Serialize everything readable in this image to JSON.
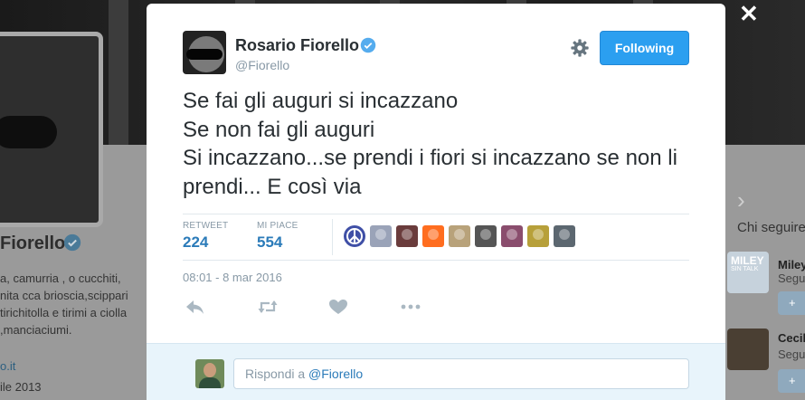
{
  "colors": {
    "accent": "#2b9ff0",
    "link": "#2b7bb9",
    "verified": "#55acee",
    "muted": "#8899a6",
    "text": "#292f33",
    "reply_bg": "#e8f4fb"
  },
  "background": {
    "profile_name": "Fiorello",
    "bio_lines": [
      "a, camurria , o cucchiti,",
      "nita cca brioscia,scippari",
      "tirichitolla e tirimi a ciolla",
      ",manciaciumi."
    ],
    "link": "o.it",
    "joined": "ile 2013",
    "who_to_follow": "Chi seguire",
    "suggestions": [
      {
        "name": "Miley",
        "sub": "Segu"
      },
      {
        "name": "Cecil",
        "sub": "Segu"
      }
    ],
    "mini_logo_text": "MILEY",
    "mini_logo_sub": "SIN TALK"
  },
  "modal": {
    "close_icon": "close-icon",
    "author": {
      "name": "Rosario Fiorello",
      "handle": "@Fiorello",
      "verified_icon": "verified-badge-icon"
    },
    "settings_icon": "gear-icon",
    "follow_button": "Following",
    "tweet_text": "Se fai gli auguri si incazzano\nSe non fai gli auguri\nSi incazzano...se prendi i fiori  si incazzano se non li prendi... E così via",
    "stats": {
      "retweet_label": "RETWEET",
      "retweet_count": "224",
      "likes_label": "MI PIACE",
      "likes_count": "554"
    },
    "likers": [
      {
        "color": "#3f4fa6",
        "icon": "peace-icon"
      },
      {
        "color": "#9aa3b8"
      },
      {
        "color": "#6a3c3c"
      },
      {
        "color": "#ff6d1f"
      },
      {
        "color": "#b8a27a"
      },
      {
        "color": "#555555"
      },
      {
        "color": "#8a4d6d"
      },
      {
        "color": "#b7a03a"
      },
      {
        "color": "#5c6770"
      }
    ],
    "timestamp": "08:01 - 8 mar 2016",
    "actions": {
      "reply_icon": "reply-icon",
      "retweet_icon": "retweet-icon",
      "like_icon": "heart-icon",
      "more_icon": "more-dots-icon"
    },
    "reply": {
      "prefix": "Rispondi a ",
      "mention": "@Fiorello"
    }
  }
}
